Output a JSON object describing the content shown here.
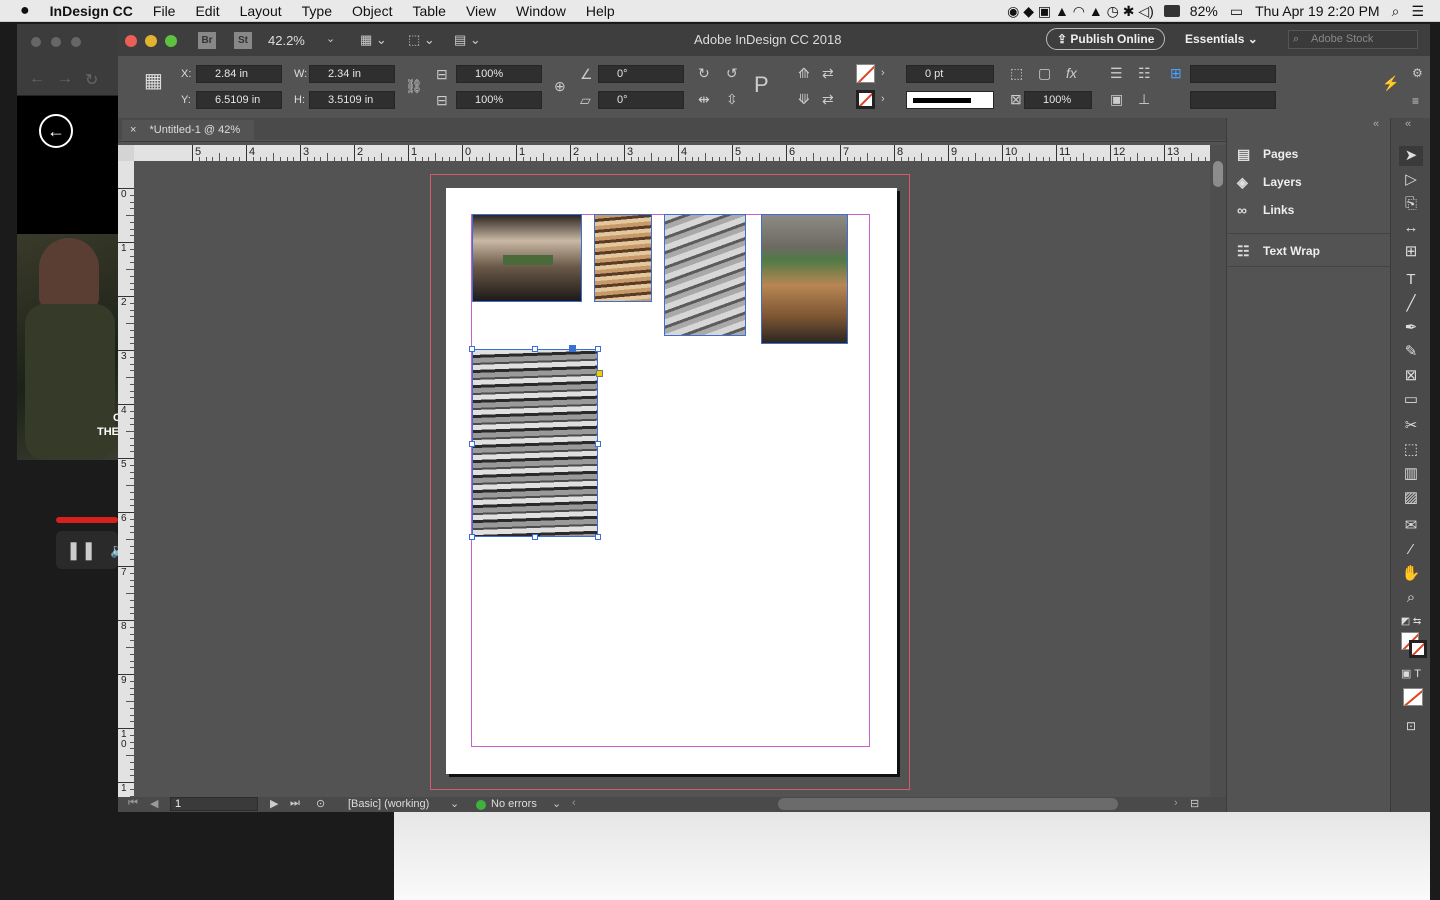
{
  "menubar": {
    "app_name": "InDesign CC",
    "items": [
      "File",
      "Edit",
      "Layout",
      "Type",
      "Object",
      "Table",
      "View",
      "Window",
      "Help"
    ],
    "battery": "82%",
    "clock": "Thu Apr 19  2:20 PM"
  },
  "window": {
    "title": "Adobe InDesign CC 2018",
    "zoom": "42.2%",
    "bridge_label": "Br",
    "stock_label": "St",
    "publish_label": "Publish Online",
    "workspace": "Essentials",
    "search_placeholder": "Adobe Stock"
  },
  "control": {
    "x_label": "X:",
    "x_value": "2.84 in",
    "y_label": "Y:",
    "y_value": "6.5109 in",
    "w_label": "W:",
    "w_value": "2.34 in",
    "h_label": "H:",
    "h_value": "3.5109 in",
    "scale_x": "100%",
    "scale_y": "100%",
    "rotate": "0°",
    "shear": "0°",
    "stroke_weight": "0 pt",
    "opacity": "100%"
  },
  "tab": {
    "close": "×",
    "label": "*Untitled-1 @ 42%"
  },
  "ruler": {
    "h_labels": [
      "5",
      "4",
      "3",
      "2",
      "1",
      "0",
      "1",
      "2",
      "3",
      "4",
      "5",
      "6",
      "7",
      "8",
      "9",
      "10",
      "11",
      "12",
      "13",
      "1"
    ],
    "v_labels": [
      "0",
      "1",
      "2",
      "3",
      "4",
      "5",
      "6",
      "7",
      "8",
      "9",
      "1 0",
      "1"
    ]
  },
  "status": {
    "page": "1",
    "style": "[Basic] (working)",
    "preflight": "No errors"
  },
  "panels": {
    "items": [
      "Pages",
      "Layers",
      "Links",
      "Text Wrap"
    ]
  },
  "background_app": {
    "caption_1": "C",
    "caption_2": "THE"
  }
}
